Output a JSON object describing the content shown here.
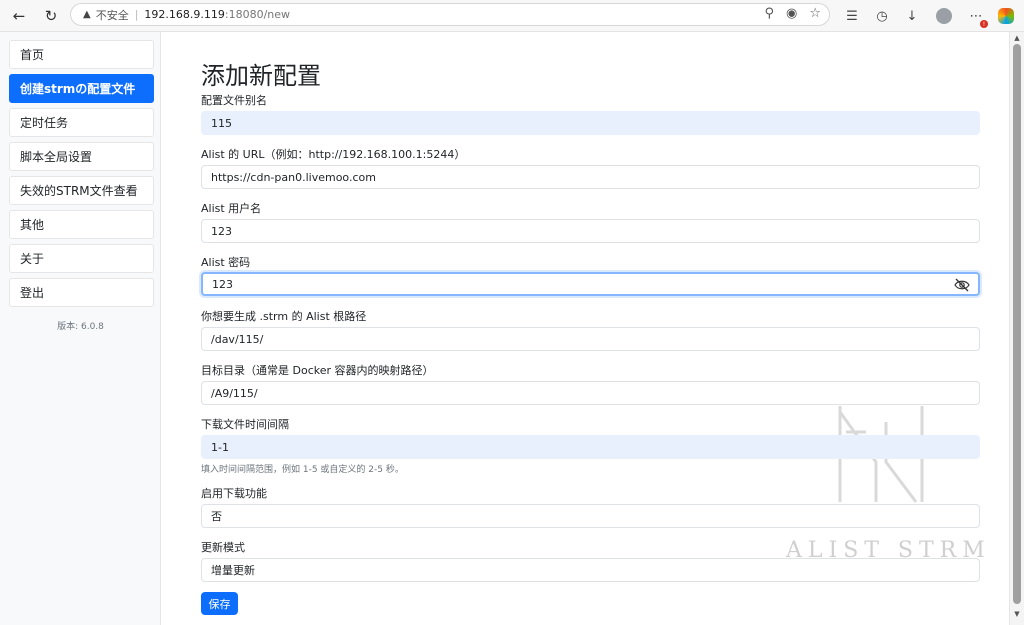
{
  "browser": {
    "security_label": "不安全",
    "url_host": "192.168.9.119",
    "url_rest": ":18080/new"
  },
  "sidebar": {
    "items": [
      {
        "label": "首页"
      },
      {
        "label": "创建strmの配置文件"
      },
      {
        "label": "定时任务"
      },
      {
        "label": "脚本全局设置"
      },
      {
        "label": "失效的STRM文件查看"
      },
      {
        "label": "其他"
      },
      {
        "label": "关于"
      },
      {
        "label": "登出"
      }
    ],
    "active_index": 1,
    "version": "版本: 6.0.8"
  },
  "main": {
    "title": "添加新配置",
    "fields": [
      {
        "label": "配置文件别名",
        "value": "115"
      },
      {
        "label": "Alist 的 URL（例如：http://192.168.100.1:5244）",
        "value": "https://cdn-pan0.livemoo.com"
      },
      {
        "label": "Alist 用户名",
        "value": "123"
      },
      {
        "label": "Alist 密码",
        "value": "123"
      },
      {
        "label": "你想要生成 .strm 的 Alist 根路径",
        "value": "/dav/115/"
      },
      {
        "label": "目标目录（通常是 Docker 容器内的映射路径）",
        "value": "/A9/115/"
      },
      {
        "label": "下载文件时间间隔",
        "value": "1-1",
        "help": "填入时间间隔范围，例如 1-5 或自定义的 2-5 秒。"
      },
      {
        "label": "启用下载功能",
        "value": "否"
      },
      {
        "label": "更新模式",
        "value": "增量更新"
      }
    ],
    "save_label": "保存",
    "watermark": "ALIST STRM"
  },
  "colors": {
    "primary": "#0d6efd",
    "autofill_bg": "#e8f0fe",
    "focus_border": "#86b7fe"
  }
}
